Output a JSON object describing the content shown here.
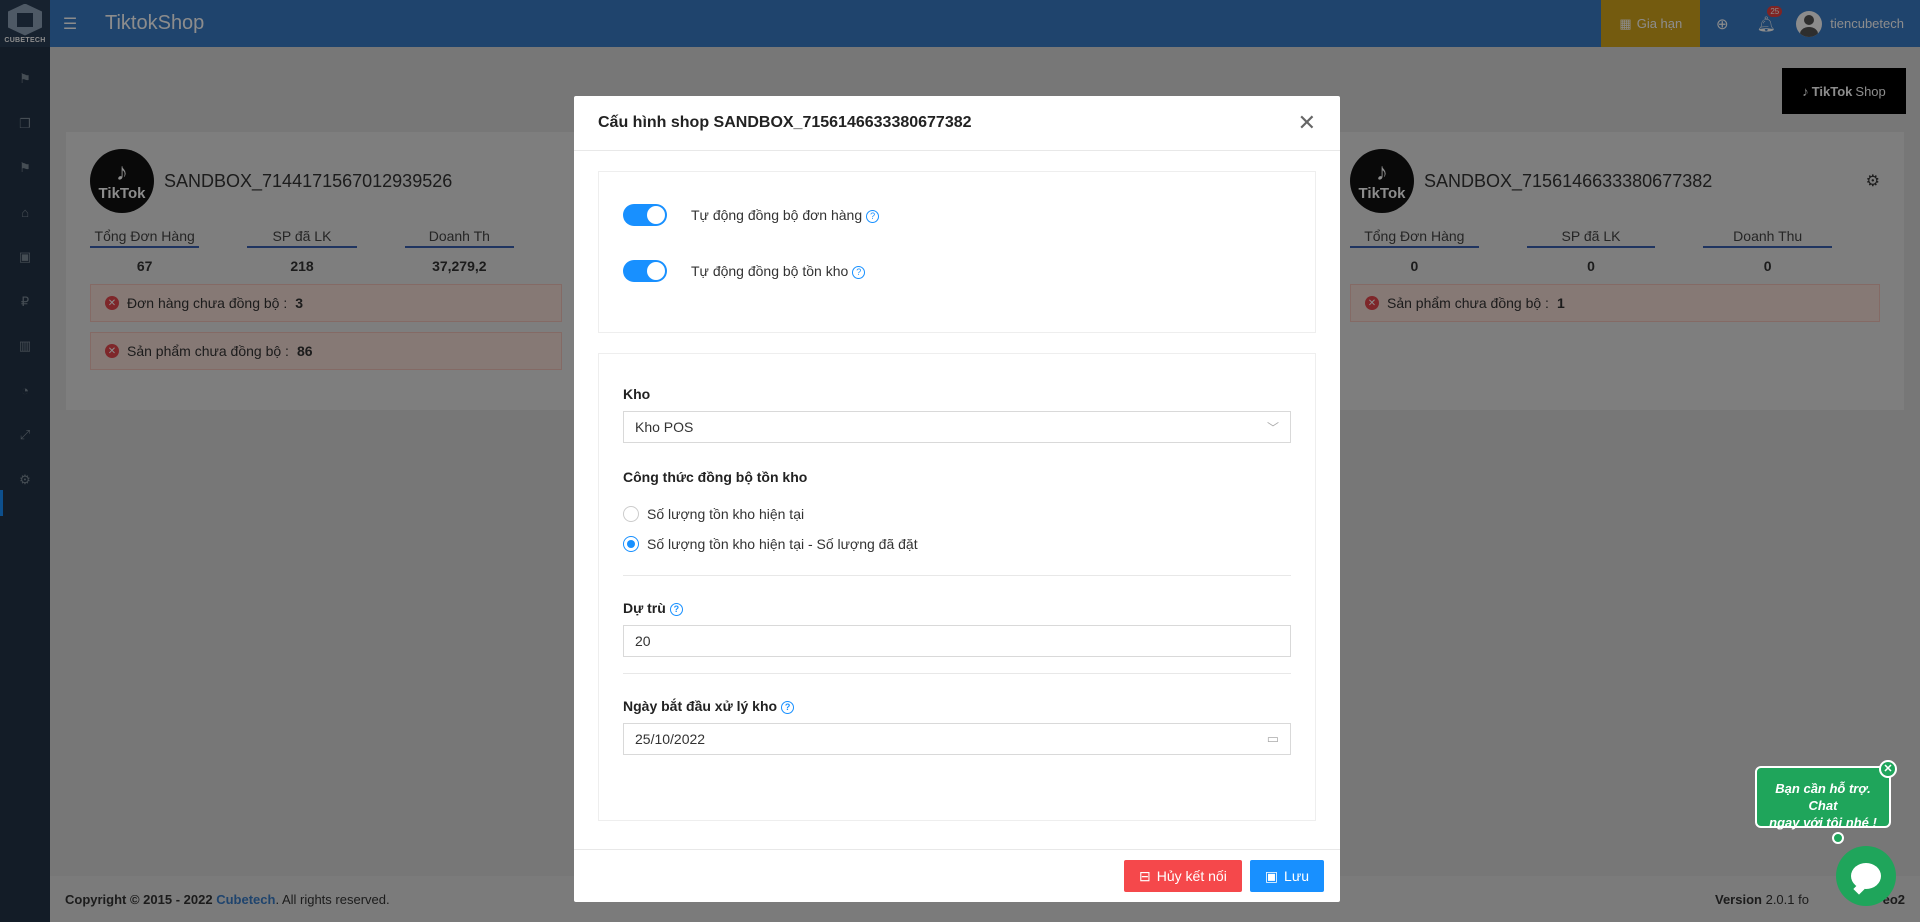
{
  "app": {
    "title": "TiktokShop",
    "logo_text": "CUBETECH"
  },
  "header": {
    "renew_label": "Gia hạn",
    "notification_count": "25",
    "username": "tiencubetech"
  },
  "content": {
    "tiktok_shop_button": {
      "brand": "TikTok",
      "label": "Shop"
    },
    "shop_cards": [
      {
        "name": "SANDBOX_7144171567012939526",
        "logo_text": "TikTok",
        "stats": [
          {
            "label": "Tổng Đơn Hàng",
            "value": "67"
          },
          {
            "label": "SP đã LK",
            "value": "218"
          },
          {
            "label": "Doanh Th",
            "value": "37,279,2"
          }
        ],
        "alerts": [
          {
            "label": "Đơn hàng chưa đồng bộ :",
            "value": "3"
          },
          {
            "label": "Sản phẩm chưa đồng bộ :",
            "value": "86"
          }
        ]
      },
      {
        "name": "SANDBOX_7156146633380677382",
        "logo_text": "TikTok",
        "stats": [
          {
            "label": "Tổng Đơn Hàng",
            "value": "0"
          },
          {
            "label": "SP đã LK",
            "value": "0"
          },
          {
            "label": "Doanh Thu",
            "value": "0"
          }
        ],
        "alerts": [
          {
            "label": "Sản phẩm chưa đồng bộ :",
            "value": "1"
          }
        ]
      }
    ]
  },
  "footer": {
    "copyright_prefix": "Copyright © 2015 - 2022",
    "brand": "Cubetech",
    "copyright_suffix": ". All rights reserved.",
    "version_label": "Version",
    "version_value": "2.0.1 fo",
    "version_tail": "eo2"
  },
  "modal": {
    "title": "Cấu hình shop SANDBOX_7156146633380677382",
    "toggles": [
      {
        "label": "Tự động đồng bộ đơn hàng",
        "on": true
      },
      {
        "label": "Tự động đồng bộ tồn kho",
        "on": true
      }
    ],
    "warehouse": {
      "label": "Kho",
      "value": "Kho POS"
    },
    "formula": {
      "label": "Công thức đồng bộ tồn kho",
      "options": [
        {
          "label": "Số lượng tồn kho hiện tại",
          "checked": false
        },
        {
          "label": "Số lượng tồn kho hiện tại - Số lượng đã đặt",
          "checked": true
        }
      ]
    },
    "reserve": {
      "label": "Dự trù",
      "value": "20"
    },
    "start_date": {
      "label": "Ngày bắt đầu xử lý kho",
      "value": "25/10/2022"
    },
    "buttons": {
      "disconnect": "Hủy kết nối",
      "save": "Lưu"
    }
  },
  "chat": {
    "line1": "Bạn cần hỗ trợ. Chat",
    "line2": "ngay với tôi nhé !"
  },
  "colors": {
    "header": "#3a7cc7",
    "sidebar": "#243447",
    "accent": "#1890ff",
    "danger": "#f5484b",
    "renew": "#d4a61c",
    "chat": "#1fa55b"
  }
}
